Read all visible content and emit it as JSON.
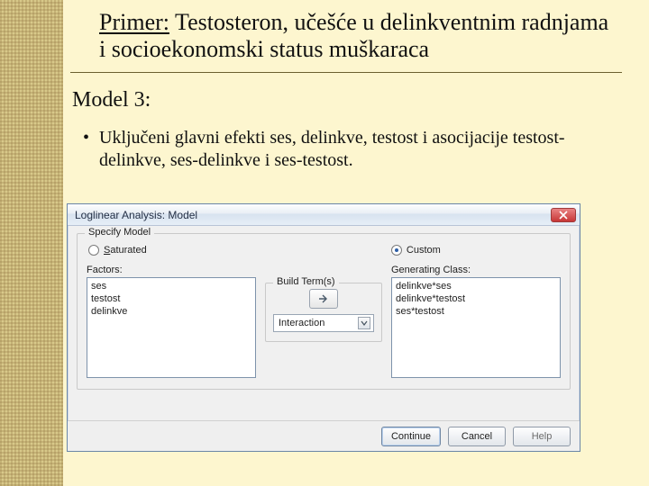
{
  "slide": {
    "title_plain": "Primer:",
    "title_rest": " Testosteron, učešće u delinkventnim radnjama i socioekonomski status muškaraca",
    "heading": "Model 3:",
    "bullet": "Uključeni glavni efekti ses, delinkve, testost i asocijacije testost-delinkve, ses-delinkve i ses-testost."
  },
  "dialog": {
    "title": "Loglinear Analysis: Model",
    "specify_model": {
      "legend": "Specify Model",
      "saturated_label_u": "S",
      "saturated_label_rest": "aturated",
      "custom_label": "Custom"
    },
    "factors_label": "Factors:",
    "factors": [
      "ses",
      "testost",
      "delinkve"
    ],
    "build_terms": {
      "legend": "Build Term(s)",
      "type": "Interaction"
    },
    "gen_class_label": "Generating Class:",
    "gen_class": [
      "delinkve*ses",
      "delinkve*testost",
      "ses*testost"
    ],
    "buttons": {
      "continue": "Continue",
      "cancel": "Cancel",
      "help": "Help"
    }
  }
}
